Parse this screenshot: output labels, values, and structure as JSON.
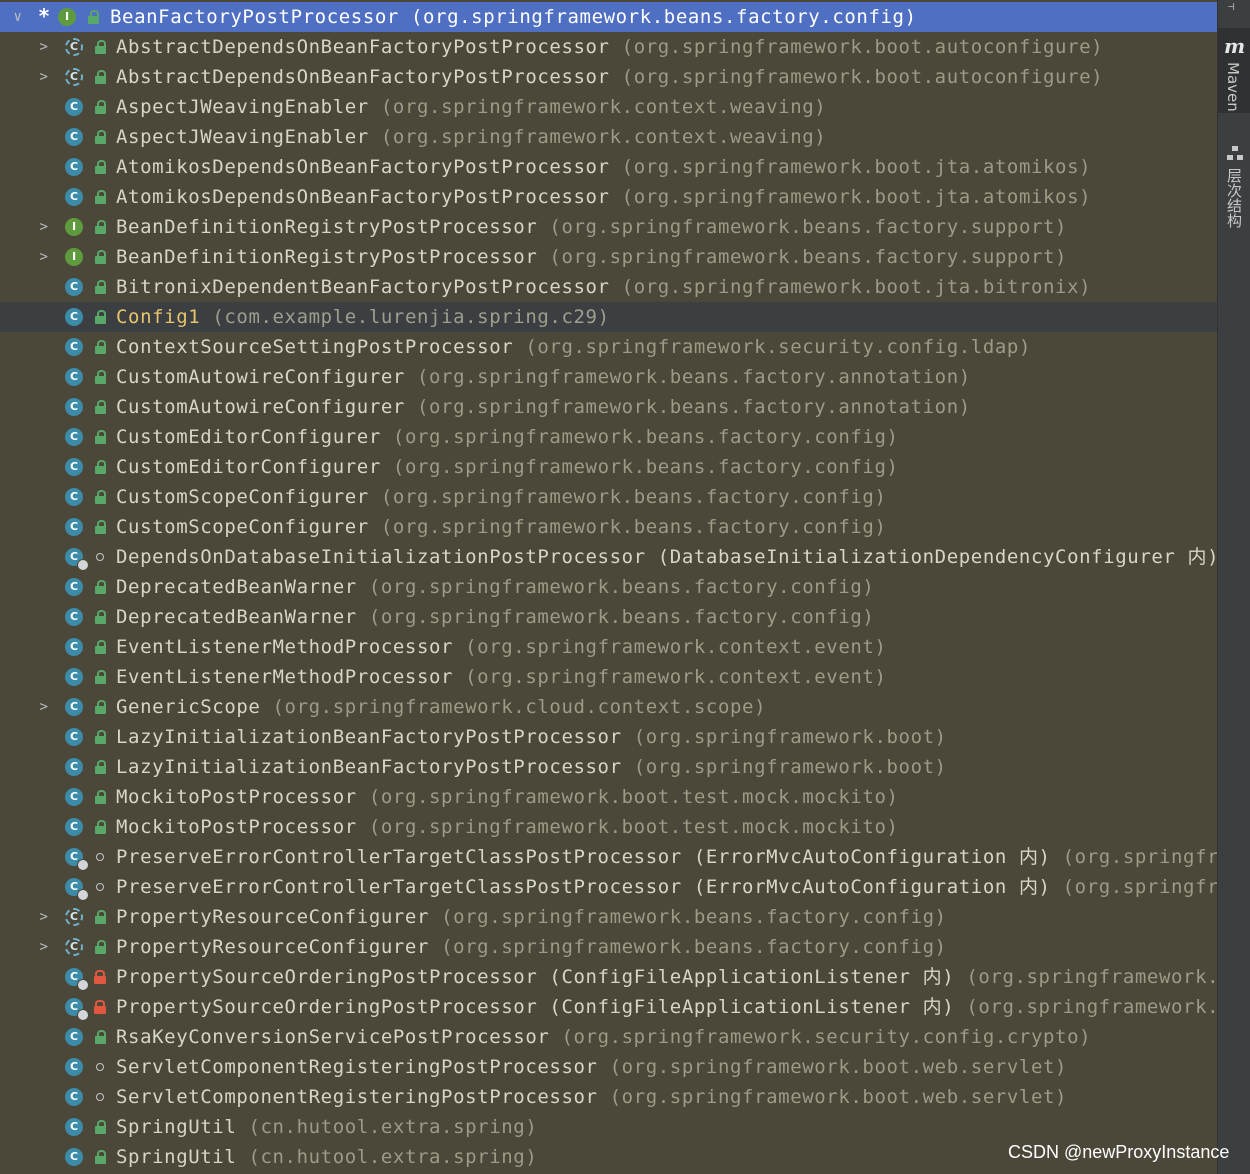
{
  "tree": {
    "root": {
      "name": "BeanFactoryPostProcessor",
      "pkg": "(org.springframework.beans.factory.config)",
      "star": "*",
      "icon_letter": "I"
    },
    "items": [
      {
        "name": "AbstractDependsOnBeanFactoryPostProcessor",
        "pkg": "(org.springframework.boot.autoconfigure)",
        "kind": "abstract",
        "access": "public",
        "expand": true,
        "icon_letter": "C"
      },
      {
        "name": "AbstractDependsOnBeanFactoryPostProcessor",
        "pkg": "(org.springframework.boot.autoconfigure)",
        "kind": "abstract",
        "access": "public",
        "expand": true,
        "icon_letter": "C"
      },
      {
        "name": "AspectJWeavingEnabler",
        "pkg": "(org.springframework.context.weaving)",
        "kind": "class",
        "access": "public",
        "expand": false,
        "icon_letter": "C"
      },
      {
        "name": "AspectJWeavingEnabler",
        "pkg": "(org.springframework.context.weaving)",
        "kind": "class",
        "access": "public",
        "expand": false,
        "icon_letter": "C"
      },
      {
        "name": "AtomikosDependsOnBeanFactoryPostProcessor",
        "pkg": "(org.springframework.boot.jta.atomikos)",
        "kind": "class",
        "access": "public",
        "expand": false,
        "icon_letter": "C"
      },
      {
        "name": "AtomikosDependsOnBeanFactoryPostProcessor",
        "pkg": "(org.springframework.boot.jta.atomikos)",
        "kind": "class",
        "access": "public",
        "expand": false,
        "icon_letter": "C"
      },
      {
        "name": "BeanDefinitionRegistryPostProcessor",
        "pkg": "(org.springframework.beans.factory.support)",
        "kind": "interface",
        "access": "public",
        "expand": true,
        "icon_letter": "I"
      },
      {
        "name": "BeanDefinitionRegistryPostProcessor",
        "pkg": "(org.springframework.beans.factory.support)",
        "kind": "interface",
        "access": "public",
        "expand": true,
        "icon_letter": "I"
      },
      {
        "name": "BitronixDependentBeanFactoryPostProcessor",
        "pkg": "(org.springframework.boot.jta.bitronix)",
        "kind": "class",
        "access": "public",
        "expand": false,
        "icon_letter": "C"
      },
      {
        "name": "Config1",
        "pkg": "(com.example.lurenjia.spring.c29)",
        "kind": "class",
        "access": "public",
        "expand": false,
        "selected": true,
        "icon_letter": "C"
      },
      {
        "name": "ContextSourceSettingPostProcessor",
        "pkg": "(org.springframework.security.config.ldap)",
        "kind": "class",
        "access": "public",
        "expand": false,
        "icon_letter": "C"
      },
      {
        "name": "CustomAutowireConfigurer",
        "pkg": "(org.springframework.beans.factory.annotation)",
        "kind": "class",
        "access": "public",
        "expand": false,
        "icon_letter": "C"
      },
      {
        "name": "CustomAutowireConfigurer",
        "pkg": "(org.springframework.beans.factory.annotation)",
        "kind": "class",
        "access": "public",
        "expand": false,
        "icon_letter": "C"
      },
      {
        "name": "CustomEditorConfigurer",
        "pkg": "(org.springframework.beans.factory.config)",
        "kind": "class",
        "access": "public",
        "expand": false,
        "icon_letter": "C"
      },
      {
        "name": "CustomEditorConfigurer",
        "pkg": "(org.springframework.beans.factory.config)",
        "kind": "class",
        "access": "public",
        "expand": false,
        "icon_letter": "C"
      },
      {
        "name": "CustomScopeConfigurer",
        "pkg": "(org.springframework.beans.factory.config)",
        "kind": "class",
        "access": "public",
        "expand": false,
        "icon_letter": "C"
      },
      {
        "name": "CustomScopeConfigurer",
        "pkg": "(org.springframework.beans.factory.config)",
        "kind": "class",
        "access": "public",
        "expand": false,
        "icon_letter": "C"
      },
      {
        "name": "DependsOnDatabaseInitializationPostProcessor",
        "inner": "(DatabaseInitializationDependencyConfigurer 内)",
        "pkg": "",
        "kind": "class",
        "badge": true,
        "access": "package",
        "expand": false,
        "icon_letter": "C"
      },
      {
        "name": "DeprecatedBeanWarner",
        "pkg": "(org.springframework.beans.factory.config)",
        "kind": "class",
        "access": "public",
        "expand": false,
        "icon_letter": "C"
      },
      {
        "name": "DeprecatedBeanWarner",
        "pkg": "(org.springframework.beans.factory.config)",
        "kind": "class",
        "access": "public",
        "expand": false,
        "icon_letter": "C"
      },
      {
        "name": "EventListenerMethodProcessor",
        "pkg": "(org.springframework.context.event)",
        "kind": "class",
        "access": "public",
        "expand": false,
        "icon_letter": "C"
      },
      {
        "name": "EventListenerMethodProcessor",
        "pkg": "(org.springframework.context.event)",
        "kind": "class",
        "access": "public",
        "expand": false,
        "icon_letter": "C"
      },
      {
        "name": "GenericScope",
        "pkg": "(org.springframework.cloud.context.scope)",
        "kind": "class",
        "access": "public",
        "expand": true,
        "icon_letter": "C"
      },
      {
        "name": "LazyInitializationBeanFactoryPostProcessor",
        "pkg": "(org.springframework.boot)",
        "kind": "class",
        "access": "public",
        "expand": false,
        "icon_letter": "C"
      },
      {
        "name": "LazyInitializationBeanFactoryPostProcessor",
        "pkg": "(org.springframework.boot)",
        "kind": "class",
        "access": "public",
        "expand": false,
        "icon_letter": "C"
      },
      {
        "name": "MockitoPostProcessor",
        "pkg": "(org.springframework.boot.test.mock.mockito)",
        "kind": "class",
        "access": "public",
        "expand": false,
        "icon_letter": "C"
      },
      {
        "name": "MockitoPostProcessor",
        "pkg": "(org.springframework.boot.test.mock.mockito)",
        "kind": "class",
        "access": "public",
        "expand": false,
        "icon_letter": "C"
      },
      {
        "name": "PreserveErrorControllerTargetClassPostProcessor",
        "inner": "(ErrorMvcAutoConfiguration 内)",
        "pkg": "(org.springfra",
        "kind": "class",
        "badge": true,
        "access": "package",
        "expand": false,
        "icon_letter": "C"
      },
      {
        "name": "PreserveErrorControllerTargetClassPostProcessor",
        "inner": "(ErrorMvcAutoConfiguration 内)",
        "pkg": "(org.springfra",
        "kind": "class",
        "badge": true,
        "access": "package",
        "expand": false,
        "icon_letter": "C"
      },
      {
        "name": "PropertyResourceConfigurer",
        "pkg": "(org.springframework.beans.factory.config)",
        "kind": "abstract",
        "access": "public",
        "expand": true,
        "icon_letter": "C"
      },
      {
        "name": "PropertyResourceConfigurer",
        "pkg": "(org.springframework.beans.factory.config)",
        "kind": "abstract",
        "access": "public",
        "expand": true,
        "icon_letter": "C"
      },
      {
        "name": "PropertySourceOrderingPostProcessor",
        "inner": "(ConfigFileApplicationListener 内)",
        "pkg": "(org.springframework.",
        "kind": "class",
        "badge": true,
        "access": "private",
        "expand": false,
        "icon_letter": "C"
      },
      {
        "name": "PropertySourceOrderingPostProcessor",
        "inner": "(ConfigFileApplicationListener 内)",
        "pkg": "(org.springframework.",
        "kind": "class",
        "badge": true,
        "access": "private",
        "expand": false,
        "icon_letter": "C"
      },
      {
        "name": "RsaKeyConversionServicePostProcessor",
        "pkg": "(org.springframework.security.config.crypto)",
        "kind": "class",
        "access": "public",
        "expand": false,
        "icon_letter": "C"
      },
      {
        "name": "ServletComponentRegisteringPostProcessor",
        "pkg": "(org.springframework.boot.web.servlet)",
        "kind": "class",
        "access": "package",
        "expand": false,
        "icon_letter": "C"
      },
      {
        "name": "ServletComponentRegisteringPostProcessor",
        "pkg": "(org.springframework.boot.web.servlet)",
        "kind": "class",
        "access": "package",
        "expand": false,
        "icon_letter": "C"
      },
      {
        "name": "SpringUtil",
        "pkg": "(cn.hutool.extra.spring)",
        "kind": "class",
        "access": "public",
        "expand": false,
        "icon_letter": "C"
      },
      {
        "name": "SpringUtil",
        "pkg": "(cn.hutool.extra.spring)",
        "kind": "class",
        "access": "public",
        "expand": false,
        "icon_letter": "C"
      }
    ]
  },
  "sidebar": {
    "maven_label": "Maven",
    "hierarchy_label": "层次结构",
    "maven_icon_text": "m"
  },
  "watermark": "CSDN @newProxyInstance",
  "colors": {
    "background": "#4b4739",
    "root_highlight": "#4f6fc3",
    "selected_row": "#3c3f41",
    "selected_text": "#e8c46a"
  }
}
